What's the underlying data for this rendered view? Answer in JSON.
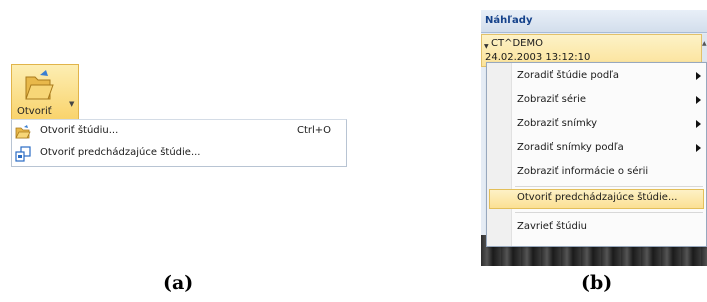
{
  "panel_a": {
    "ribbon_button": {
      "label": "Otvoriť",
      "icon": "open-folder-icon"
    },
    "menu": [
      {
        "label": "Otvoriť štúdiu...",
        "shortcut": "Ctrl+O",
        "icon": "open-folder-icon"
      },
      {
        "label": "Otvoriť predchádzajúce štúdie...",
        "shortcut": "",
        "icon": "previous-studies-icon"
      }
    ],
    "caption": "(a)"
  },
  "panel_b": {
    "header": "Náhľady",
    "series": {
      "name": "CT^DEMO",
      "date": "24.02.2003 13:12:10"
    },
    "menu": [
      {
        "label": "Zoradiť štúdie podľa",
        "submenu": true
      },
      {
        "label": "Zobraziť série",
        "submenu": true
      },
      {
        "label": "Zobraziť snímky",
        "submenu": true
      },
      {
        "label": "Zoradiť snímky podľa",
        "submenu": true
      },
      {
        "label": "Zobraziť informácie o sérii",
        "submenu": false
      },
      {
        "label": "Otvoriť predchádzajúce štúdie...",
        "submenu": false,
        "highlighted": true
      },
      {
        "label": "Zavrieť štúdiu",
        "submenu": false
      }
    ],
    "caption": "(b)"
  },
  "colors": {
    "highlight": "#fbe39b",
    "header_text": "#15428b"
  }
}
